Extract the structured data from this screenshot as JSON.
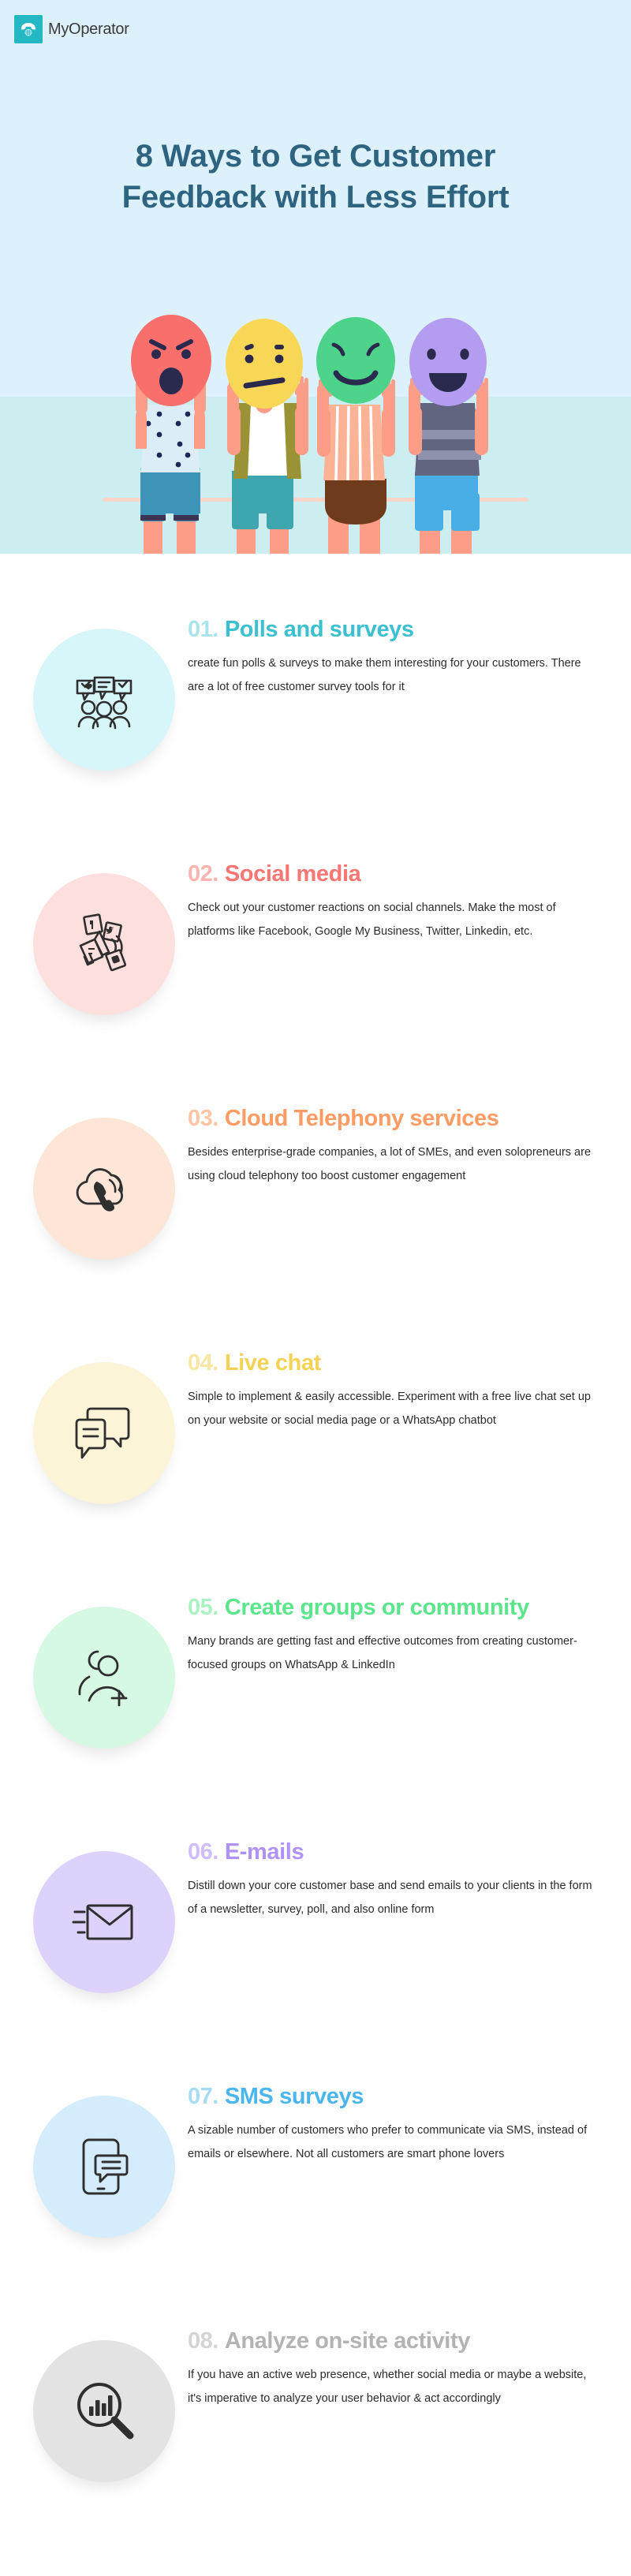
{
  "brand": {
    "name": "MyOperator",
    "logo_icon": "telephone-icon",
    "logo_bg": "#24b8c4"
  },
  "hero": {
    "title_line1": "8 Ways to Get Customer",
    "title_line2": "Feedback with Less Effort",
    "title_color": "#2e6480",
    "bg_top": "#dcf1fc",
    "bg_bottom": "#cdeef0",
    "illustration": "four-people-holding-emoji-face-masks",
    "faces": [
      {
        "emotion": "angry",
        "color": "#f96f6c"
      },
      {
        "emotion": "neutral",
        "color": "#f9d756"
      },
      {
        "emotion": "smiling",
        "color": "#4ed48a"
      },
      {
        "emotion": "happy",
        "color": "#b49cf0"
      }
    ]
  },
  "items": [
    {
      "number": "01.",
      "title": "Polls and surveys",
      "desc": "create fun polls & surveys to make them interesting for your customers. There are a lot of free customer survey tools for it",
      "color": "#3bc0cf",
      "num_color": "#a9e4ec",
      "circle_bg": "#d7f6fa",
      "icon": "speech-bubbles-people-icon"
    },
    {
      "number": "02.",
      "title": "Social media",
      "desc": "Check out your customer reactions on social channels. Make the most of platforms like Facebook, Google My Business, Twitter, Linkedin, etc.",
      "color": "#fa7672",
      "num_color": "#fcb4b1",
      "circle_bg": "#fddfdd",
      "icon": "megaphone-social-icon"
    },
    {
      "number": "03.",
      "title": "Cloud Telephony services",
      "desc": "Besides enterprise-grade companies, a lot of SMEs, and even solopreneurs are using cloud telephony too boost customer engagement",
      "color": "#ff9b63",
      "num_color": "#ffc5a3",
      "circle_bg": "#fde6d8",
      "icon": "cloud-phone-icon"
    },
    {
      "number": "04.",
      "title": "Live chat",
      "desc": "Simple to implement & easily accessible. Experiment with a free live chat set up on your website or social media page or a WhatsApp chatbot",
      "color": "#f3d256",
      "num_color": "#f8e7a3",
      "circle_bg": "#fcf4d7",
      "icon": "chat-bubbles-icon"
    },
    {
      "number": "05.",
      "title": "Create groups or community",
      "desc": "Many brands are getting fast and effective outcomes from creating customer-focused groups on WhatsApp & LinkedIn",
      "color": "#5ce68c",
      "num_color": "#a9f2c2",
      "circle_bg": "#d5f9e2",
      "icon": "add-user-group-icon"
    },
    {
      "number": "06.",
      "title": "E-mails",
      "desc": "Distill down your core customer base and send emails to your clients in the form of a newsletter, survey, poll, and also online form",
      "color": "#af92f7",
      "num_color": "#cfbcfb",
      "circle_bg": "#ddd2fb",
      "icon": "envelope-icon"
    },
    {
      "number": "07.",
      "title": "SMS surveys",
      "desc": "A sizable number of customers who prefer to communicate via SMS, instead of emails or elsewhere. Not all customers are smart phone lovers",
      "color": "#4bb6ee",
      "num_color": "#a5dbf7",
      "circle_bg": "#d4ecfb",
      "icon": "phone-message-icon"
    },
    {
      "number": "08.",
      "title": "Analyze on-site activity",
      "desc": "If you have an active web presence, whether social media or maybe a website, it's imperative to analyze your user behavior & act accordingly",
      "color": "#b3b3b3",
      "num_color": "#d4d4d4",
      "circle_bg": "#e3e3e3",
      "icon": "magnifier-chart-icon"
    }
  ]
}
